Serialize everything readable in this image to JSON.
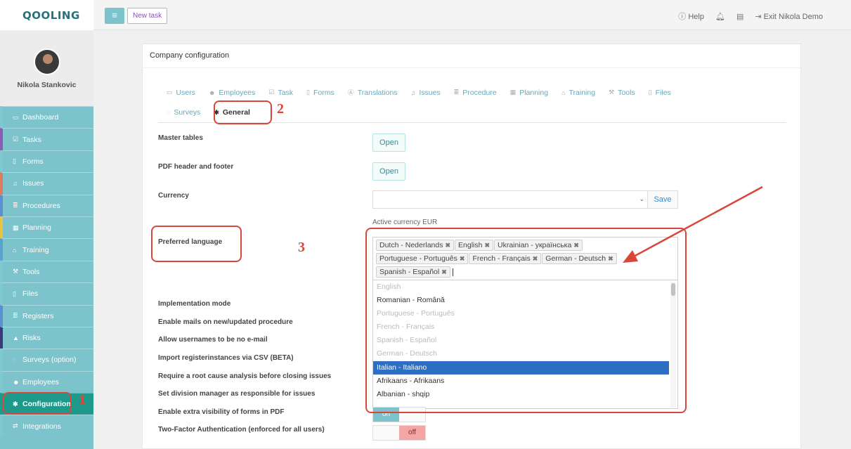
{
  "logo": "QOOLING",
  "profile": {
    "name": "Nikola Stankovic"
  },
  "sidebar": {
    "items": [
      {
        "label": "Dashboard",
        "icon": "monitor-icon"
      },
      {
        "label": "Tasks",
        "icon": "check-square-icon"
      },
      {
        "label": "Forms",
        "icon": "file-icon"
      },
      {
        "label": "Issues",
        "icon": "bell-icon"
      },
      {
        "label": "Procedures",
        "icon": "list-icon"
      },
      {
        "label": "Planning",
        "icon": "calendar-icon"
      },
      {
        "label": "Training",
        "icon": "graduation-cap-icon"
      },
      {
        "label": "Tools",
        "icon": "wrench-icon"
      },
      {
        "label": "Files",
        "icon": "file-icon"
      },
      {
        "label": "Registers",
        "icon": "list-icon"
      },
      {
        "label": "Risks",
        "icon": "warning-icon"
      },
      {
        "label": "Surveys (option)",
        "icon": "comment-icon"
      },
      {
        "label": "Employees",
        "icon": "users-icon"
      },
      {
        "label": "Configuration",
        "icon": "gear-icon"
      },
      {
        "label": "Integrations",
        "icon": "exchange-icon"
      }
    ],
    "accent_colors": [
      "#7ec9d0",
      "#8b5cb5",
      "#7ec9d0",
      "#e07a5f",
      "#5a8fd0",
      "#e8c547",
      "#5aa0d0",
      "#7ec9d0",
      "#7ec9d0",
      "#5a8fd0",
      "#3a3a7a",
      "#7ec9d0",
      "#7ec9d0",
      "#1d9a8c",
      "#7ec9d0"
    ]
  },
  "topbar": {
    "new_task": "New task",
    "help": "Help",
    "exit": "Exit Nikola Demo"
  },
  "card": {
    "title": "Company configuration",
    "tabs": [
      {
        "label": "Users",
        "icon": "id-card-icon"
      },
      {
        "label": "Employees",
        "icon": "users-icon"
      },
      {
        "label": "Task",
        "icon": "check-square-icon"
      },
      {
        "label": "Forms",
        "icon": "file-icon"
      },
      {
        "label": "Translations",
        "icon": "translate-icon"
      },
      {
        "label": "Issues",
        "icon": "bell-icon"
      },
      {
        "label": "Procedure",
        "icon": "list-icon"
      },
      {
        "label": "Planning",
        "icon": "calendar-icon"
      },
      {
        "label": "Training",
        "icon": "graduation-cap-icon"
      },
      {
        "label": "Tools",
        "icon": "wrench-icon"
      },
      {
        "label": "Files",
        "icon": "file-icon"
      }
    ],
    "tabs_row2": [
      {
        "label": "Surveys",
        "icon": "comment-icon"
      },
      {
        "label": "General",
        "icon": "gear-icon"
      }
    ],
    "master_tables": "Master tables",
    "pdf_header": "PDF header and footer",
    "open": "Open",
    "currency": "Currency",
    "save": "Save",
    "active_currency": "Active currency EUR",
    "preferred_language": "Preferred language",
    "selected_languages": [
      "Dutch - Nederlands",
      "English",
      "Ukrainian - українська",
      "Portuguese - Português",
      "French - Français",
      "German - Deutsch",
      "Spanish - Español"
    ],
    "language_options": [
      {
        "label": "English",
        "disabled": true
      },
      {
        "label": "Romanian - Română",
        "disabled": false
      },
      {
        "label": "Portuguese - Português",
        "disabled": true
      },
      {
        "label": "French - Français",
        "disabled": true
      },
      {
        "label": "Spanish - Español",
        "disabled": true
      },
      {
        "label": "German - Deutsch",
        "disabled": true
      },
      {
        "label": "Italian - Italiano",
        "selected": true
      },
      {
        "label": "Afrikaans - Afrikaans",
        "disabled": false
      },
      {
        "label": "Albanian - shqip",
        "disabled": false
      }
    ],
    "settings": [
      "Implementation mode",
      "Enable mails on new/updated procedure",
      "Allow usernames to be no e-mail",
      "Import registerinstances via CSV (BETA)",
      "Require a root cause analysis before closing issues",
      "Set division manager as responsible for issues",
      "Enable extra visibility of forms in PDF",
      "Two-Factor Authentication (enforced for all users)"
    ],
    "toggle_on": "on",
    "toggle_off": "off"
  },
  "annotations": [
    "1",
    "2",
    "3"
  ]
}
